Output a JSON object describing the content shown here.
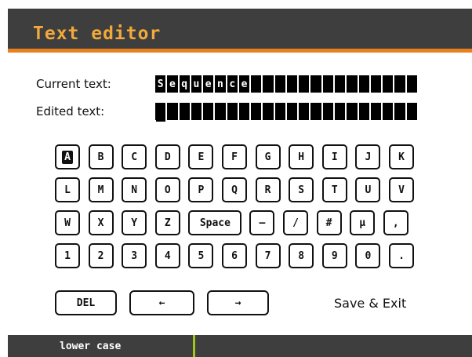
{
  "title": "Text editor",
  "current_label": "Current text:",
  "edited_label": "Edited text:",
  "current_text": [
    "S",
    "e",
    "q",
    "u",
    "e",
    "n",
    "c",
    "e",
    "",
    "",
    "",
    "",
    "",
    "",
    "",
    "",
    "",
    "",
    "",
    "",
    "",
    ""
  ],
  "edited_text": [
    "",
    "",
    "",
    "",
    "",
    "",
    "",
    "",
    "",
    "",
    "",
    "",
    "",
    "",
    "",
    "",
    "",
    "",
    "",
    "",
    "",
    ""
  ],
  "keyboard": {
    "rows": [
      [
        "A",
        "B",
        "C",
        "D",
        "E",
        "F",
        "G",
        "H",
        "I",
        "J",
        "K"
      ],
      [
        "L",
        "M",
        "N",
        "O",
        "P",
        "Q",
        "R",
        "S",
        "T",
        "U",
        "V"
      ],
      [
        "W",
        "X",
        "Y",
        "Z",
        "Space",
        "–",
        "/",
        "#",
        "µ",
        ","
      ],
      [
        "1",
        "2",
        "3",
        "4",
        "5",
        "6",
        "7",
        "8",
        "9",
        "0",
        "."
      ]
    ],
    "selected": "A"
  },
  "buttons": {
    "del": "DEL",
    "left": "←",
    "right": "→",
    "save_exit": "Save & Exit"
  },
  "status": {
    "mode": "lower case",
    "accent": "#a0c71f"
  },
  "colors": {
    "title_bg": "#3e3e3e",
    "title_text": "#f2a93b",
    "title_border": "#e8801f"
  }
}
